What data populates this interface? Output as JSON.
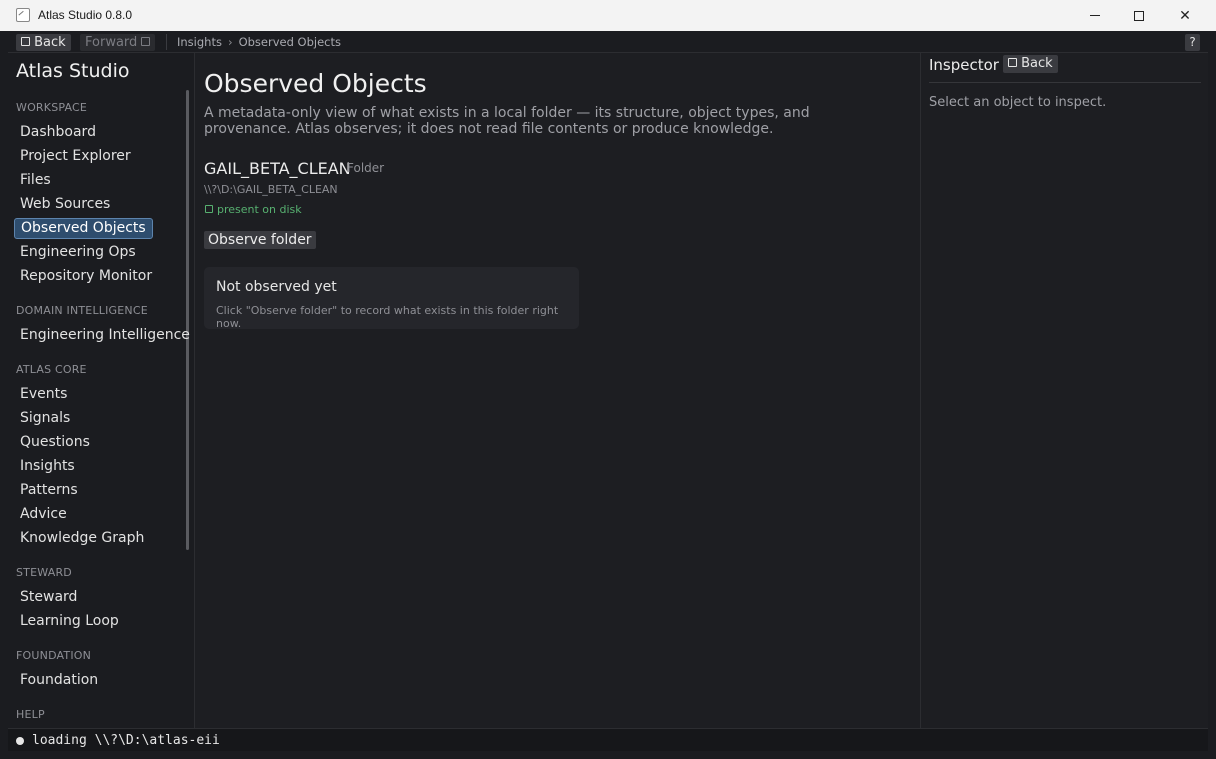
{
  "window": {
    "title": "Atlas Studio 0.8.0",
    "minimize_glyph": "",
    "maximize_glyph": "",
    "close_glyph": "✕"
  },
  "toolbar": {
    "back_label": "Back",
    "forward_label": "Forward",
    "help_label": "?",
    "breadcrumb": [
      "Insights",
      "Observed Objects"
    ],
    "breadcrumb_separator": "›"
  },
  "sidebar": {
    "brand": "Atlas Studio",
    "sections": [
      {
        "label": "WORKSPACE",
        "items": [
          "Dashboard",
          "Project Explorer",
          "Files",
          "Web Sources",
          "Observed Objects",
          "Engineering Ops",
          "Repository Monitor"
        ]
      },
      {
        "label": "DOMAIN INTELLIGENCE",
        "items": [
          "Engineering Intelligence"
        ]
      },
      {
        "label": "ATLAS CORE",
        "items": [
          "Events",
          "Signals",
          "Questions",
          "Insights",
          "Patterns",
          "Advice",
          "Knowledge Graph"
        ]
      },
      {
        "label": "STEWARD",
        "items": [
          "Steward",
          "Learning Loop"
        ]
      },
      {
        "label": "FOUNDATION",
        "items": [
          "Foundation"
        ]
      },
      {
        "label": "HELP",
        "items": []
      }
    ],
    "active_item": "Observed Objects"
  },
  "main": {
    "title": "Observed Objects",
    "description": "A metadata-only view of what exists in a local folder — its structure, object types, and provenance. Atlas observes; it does not read file contents or produce knowledge.",
    "folder": {
      "name": "GAIL_BETA_CLEAN",
      "type": "Folder",
      "path": "\\\\?\\D:\\GAIL_BETA_CLEAN",
      "status": "present on disk",
      "status_color": "#57b070"
    },
    "observe_button": "Observe folder",
    "card": {
      "title": "Not observed yet",
      "body": "Click \"Observe folder\" to record what exists in this folder right now."
    }
  },
  "inspector": {
    "title": "Inspector",
    "back_label": "Back",
    "empty_text": "Select an object to inspect."
  },
  "statusbar": {
    "text": "loading \\\\?\\D:\\atlas-eii"
  },
  "colors": {
    "accent": "#2e4d6e",
    "accent_border": "#5d84ad",
    "background": "#1d1e22"
  }
}
